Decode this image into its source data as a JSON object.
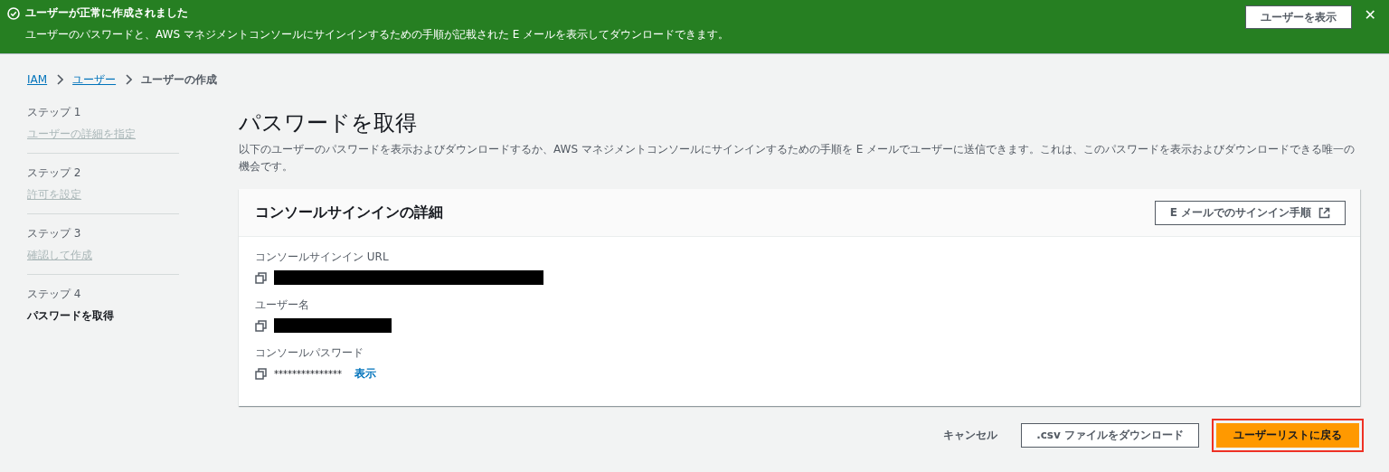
{
  "flash": {
    "title": "ユーザーが正常に作成されました",
    "message": "ユーザーのパスワードと、AWS マネジメントコンソールにサインインするための手順が記載された E メールを表示してダウンロードできます。",
    "action": "ユーザーを表示",
    "dismiss": "✕"
  },
  "breadcrumb": [
    {
      "label": "IAM",
      "link": true
    },
    {
      "label": "ユーザー",
      "link": true
    },
    {
      "label": "ユーザーの作成",
      "link": false
    }
  ],
  "steps": [
    {
      "number": "ステップ 1",
      "title": "ユーザーの詳細を指定",
      "selected": false
    },
    {
      "number": "ステップ 2",
      "title": "許可を設定",
      "selected": false
    },
    {
      "number": "ステップ 3",
      "title": "確認して作成",
      "selected": false
    },
    {
      "number": "ステップ 4",
      "title": "パスワードを取得",
      "selected": true
    }
  ],
  "heading": "パスワードを取得",
  "description": "以下のユーザーのパスワードを表示およびダウンロードするか、AWS マネジメントコンソールにサインインするための手順を E メールでユーザーに送信できます。これは、このパスワードを表示およびダウンロードできる唯一の機会です。",
  "panel": {
    "title": "コンソールサインインの詳細",
    "email_button": "E メールでのサインイン手順",
    "fields": [
      {
        "label": "コンソールサインイン URL",
        "kind": "url"
      },
      {
        "label": "ユーザー名",
        "kind": "username"
      },
      {
        "label": "コンソールパスワード",
        "kind": "password",
        "value": "***************",
        "show_link": "表示"
      }
    ]
  },
  "footer": {
    "cancel": "キャンセル",
    "download": ".csv ファイルをダウンロード",
    "primary": "ユーザーリストに戻る",
    "primary_highlighted": true
  }
}
